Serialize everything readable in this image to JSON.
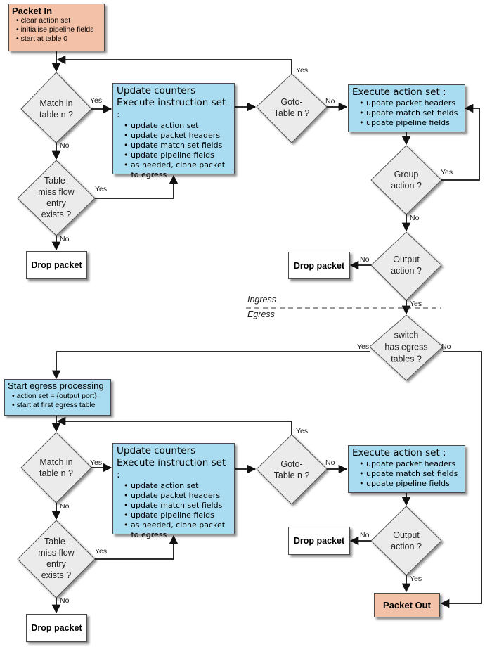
{
  "colors": {
    "start_end_fill": "#f3c1a8",
    "process_fill": "#a9dcf0",
    "decision_fill": "#ebebeb",
    "drop_fill": "#ffffff",
    "stroke": "#111111"
  },
  "ingress": {
    "packet_in": {
      "title": "Packet In",
      "bullets": [
        "• clear action set",
        "• initialise pipeline fields",
        "• start at table 0"
      ]
    },
    "match": "Match in\ntable n ?",
    "table_miss": "Table-\nmiss flow\nentry\nexists ?",
    "drop_left": "Drop packet",
    "instructions": {
      "line1": "Update counters",
      "line2": "Execute instruction set :",
      "bullets": [
        "• update action set",
        "• update packet headers",
        "• update match set fields",
        "• update pipeline fields",
        "• as needed, clone packet",
        "   to egress"
      ]
    },
    "goto": "Goto-\nTable n ?",
    "action_set": {
      "title": "Execute action set :",
      "bullets": [
        "• update packet headers",
        "• update match set fields",
        "• update pipeline fields"
      ]
    },
    "group": "Group\naction ?",
    "output": "Output\naction ?",
    "drop_right": "Drop packet"
  },
  "divider": {
    "above": "Ingress",
    "below": "Egress"
  },
  "switch": "switch\nhas egress\ntables ?",
  "egress": {
    "start": {
      "title": "Start egress processing",
      "bullets": [
        "• action set = {output port}",
        "• start at first egress table"
      ]
    },
    "match": "Match in\ntable n ?",
    "table_miss": "Table-\nmiss flow\nentry\nexists ?",
    "drop_left": "Drop packet",
    "instructions": {
      "line1": "Update counters",
      "line2": "Execute instruction set :",
      "bullets": [
        "• update action set",
        "• update packet headers",
        "• update match set fields",
        "• update pipeline fields",
        "• as needed, clone packet",
        "   to egress"
      ]
    },
    "goto": "Goto-\nTable n ?",
    "action_set": {
      "title": "Execute action set :",
      "bullets": [
        "• update packet headers",
        "• update match set fields",
        "• update pipeline fields"
      ]
    },
    "output": "Output\naction ?",
    "drop_right": "Drop packet",
    "packet_out": "Packet Out"
  },
  "edge_labels": {
    "yes": "Yes",
    "no": "No"
  }
}
